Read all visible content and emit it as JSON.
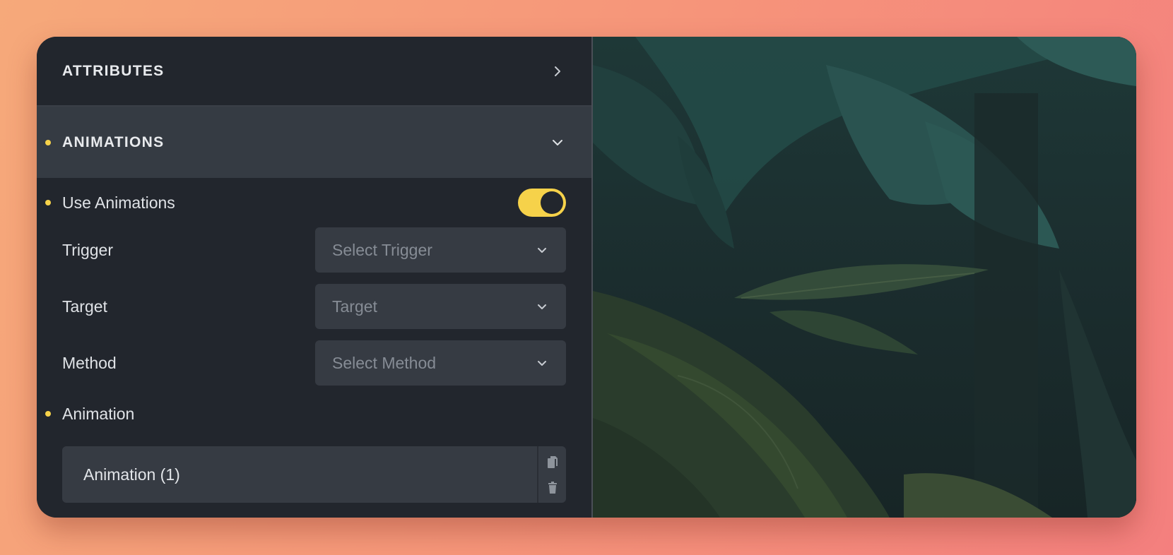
{
  "sections": {
    "attributes": {
      "title": "ATTRIBUTES",
      "icon": "chevron-right-icon"
    },
    "animations": {
      "title": "ANIMATIONS",
      "icon": "chevron-down-icon",
      "expanded": true
    }
  },
  "animations": {
    "use_animations": {
      "label": "Use Animations",
      "enabled": true
    },
    "trigger": {
      "label": "Trigger",
      "placeholder": "Select Trigger"
    },
    "target": {
      "label": "Target",
      "placeholder": "Target"
    },
    "method": {
      "label": "Method",
      "placeholder": "Select Method"
    },
    "animation": {
      "label": "Animation",
      "items": [
        {
          "label": "Animation (1)"
        }
      ]
    }
  },
  "colors": {
    "accent": "#f6d24a",
    "panel_bg": "#22262d",
    "header_active_bg": "#353b43",
    "input_bg": "#363b43"
  },
  "icons": {
    "copy": "copy-icon",
    "delete": "trash-icon",
    "chevron_down": "chevron-down-icon",
    "chevron_right": "chevron-right-icon"
  }
}
